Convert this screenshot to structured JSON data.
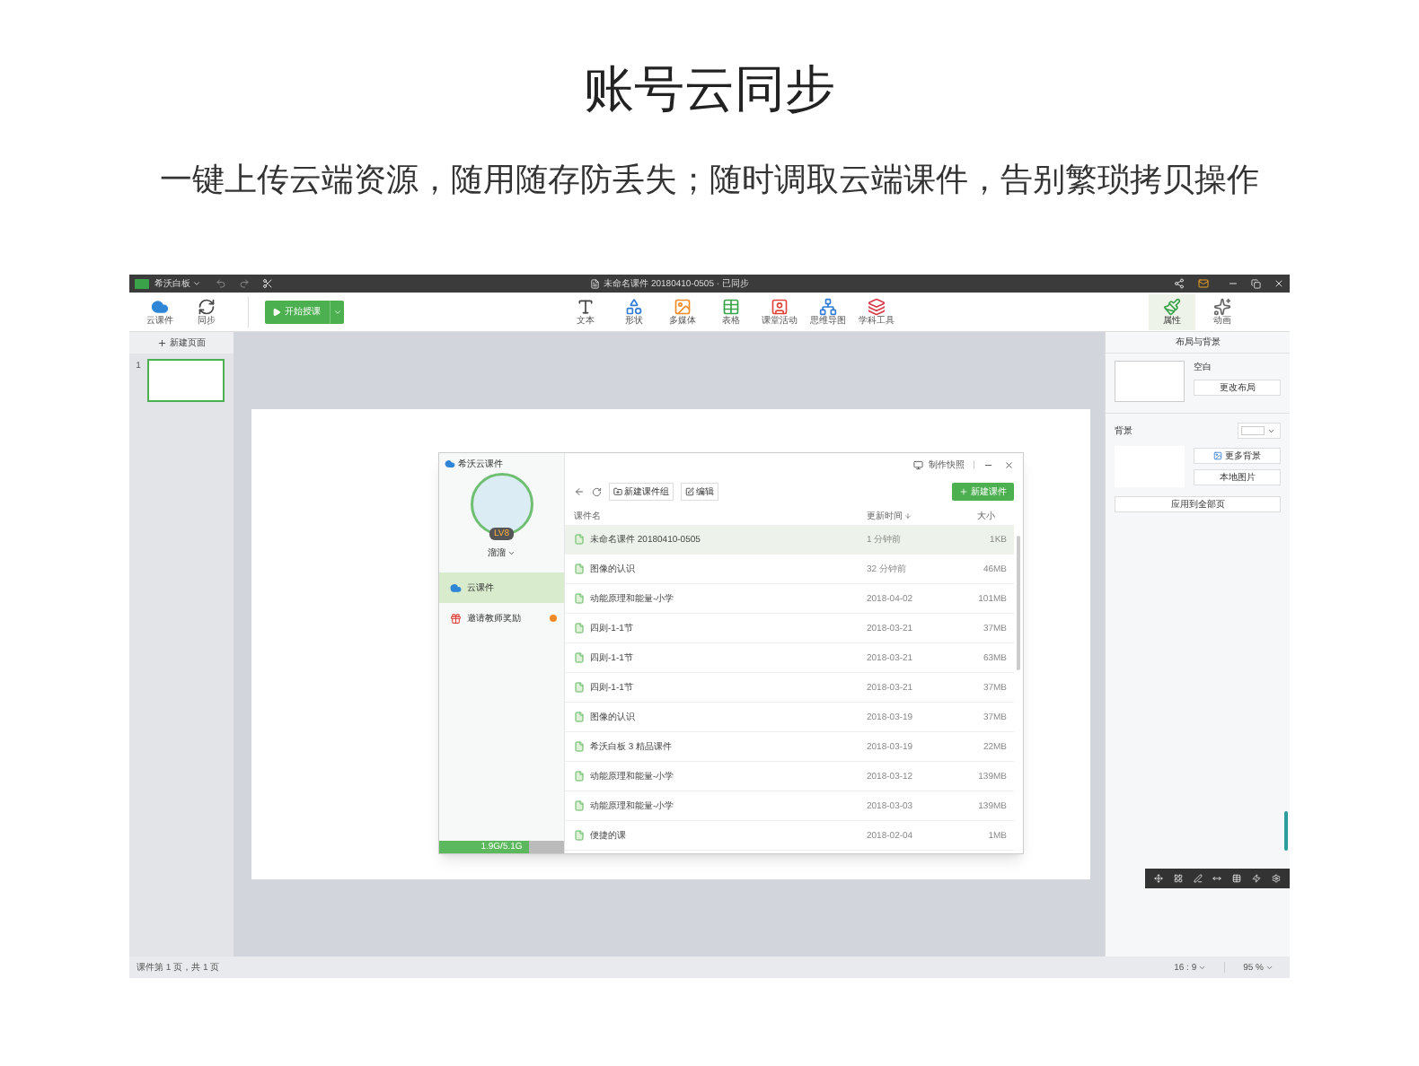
{
  "heading": "账号云同步",
  "subtitle": "一键上传云端资源，随用随存防丢失；随时调取云端课件，告别繁琐拷贝操作",
  "app": {
    "app_name": "希沃白板",
    "doc_title": "未命名课件 20180410-0505 · 已同步",
    "toolbar_left": [
      {
        "kind": "cloud",
        "label": "云课件"
      },
      {
        "kind": "sync",
        "label": "同步"
      }
    ],
    "start_button": "开始授课",
    "tools": [
      {
        "kind": "text",
        "label": "文本"
      },
      {
        "kind": "shape",
        "label": "形状"
      },
      {
        "kind": "media",
        "label": "多媒体"
      },
      {
        "kind": "table",
        "label": "表格"
      },
      {
        "kind": "activity",
        "label": "课堂活动"
      },
      {
        "kind": "mindmap",
        "label": "思维导图"
      },
      {
        "kind": "subject",
        "label": "学科工具"
      }
    ],
    "right_tools": [
      {
        "kind": "brush",
        "label": "属性",
        "selected": true
      },
      {
        "kind": "animation",
        "label": "动画",
        "selected": false
      }
    ],
    "new_page": "新建页面",
    "pages": [
      {
        "number": "1",
        "selected": true
      }
    ],
    "panel": {
      "title": "布局与背景",
      "layout_name": "空白",
      "change_layout": "更改布局",
      "background_label": "背景",
      "more_backgrounds": "更多背景",
      "local_image": "本地图片",
      "apply_all": "应用到全部页"
    },
    "dialog": {
      "brand": "希沃云课件",
      "user": "溜溜",
      "level_badge": "LV8",
      "nav": [
        {
          "kind": "cloud",
          "label": "云课件",
          "selected": true,
          "badge": false
        },
        {
          "kind": "gift",
          "label": "邀请教师奖励",
          "selected": false,
          "badge": true
        }
      ],
      "storage": {
        "text": "1.9G/5.1G",
        "level": 0.72
      },
      "snapshot": "制作快照",
      "new_group": "新建课件组",
      "edit": "编辑",
      "new_file": "新建课件",
      "columns": [
        "课件名",
        "更新时间",
        "大小"
      ],
      "rows": [
        {
          "name": "未命名课件 20180410-0505",
          "time": "1 分钟前",
          "size": "1KB",
          "selected": true
        },
        {
          "name": "图像的认识",
          "time": "32 分钟前",
          "size": "46MB",
          "selected": false
        },
        {
          "name": "动能原理和能量-小学",
          "time": "2018-04-02",
          "size": "101MB",
          "selected": false
        },
        {
          "name": "四则-1-1节",
          "time": "2018-03-21",
          "size": "37MB",
          "selected": false
        },
        {
          "name": "四则-1-1节",
          "time": "2018-03-21",
          "size": "63MB",
          "selected": false
        },
        {
          "name": "四则-1-1节",
          "time": "2018-03-21",
          "size": "37MB",
          "selected": false
        },
        {
          "name": "图像的认识",
          "time": "2018-03-19",
          "size": "37MB",
          "selected": false
        },
        {
          "name": "希沃白板 3 精品课件",
          "time": "2018-03-19",
          "size": "22MB",
          "selected": false
        },
        {
          "name": "动能原理和能量-小学",
          "time": "2018-03-12",
          "size": "139MB",
          "selected": false
        },
        {
          "name": "动能原理和能量-小学",
          "time": "2018-03-03",
          "size": "139MB",
          "selected": false
        },
        {
          "name": "便捷的课",
          "time": "2018-02-04",
          "size": "1MB",
          "selected": false
        }
      ]
    },
    "status": {
      "page_info": "课件第 1 页，共 1 页",
      "ratio": "16 : 9",
      "zoom": "95 %"
    }
  }
}
